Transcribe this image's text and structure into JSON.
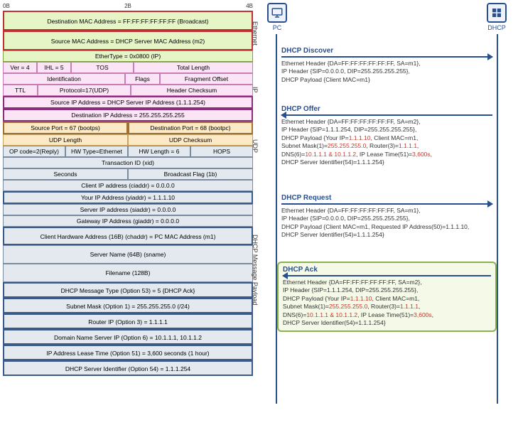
{
  "ruler": {
    "a": "0B",
    "b": "2B",
    "c": "4B"
  },
  "eth": {
    "dst": "Destination MAC Address = FF:FF:FF:FF:FF:FF (Broadcast)",
    "src": "Source MAC Address = DHCP Server MAC Address (m2)",
    "etype": "EtherType = 0x0800 (IP)",
    "label": "Ethernet"
  },
  "ip": {
    "ver": "Ver = 4",
    "ihl": "IHL = 5",
    "tos": "TOS",
    "tlen": "Total Length",
    "ident": "Identification",
    "flags": "Flags",
    "frag": "Fragment Offset",
    "ttl": "TTL",
    "proto": "Protocol=17(UDP)",
    "hcsum": "Header Checksum",
    "sip": "Source IP Address = DHCP Server IP Address (1.1.1.254)",
    "dip": "Destination IP Address = 255.255.255.255",
    "label": "IP"
  },
  "udp": {
    "sport": "Source Port = 67 (bootps)",
    "dport": "Destination Port = 68 (bootpc)",
    "len": "UDP Length",
    "csum": "UDP Checksum",
    "label": "UDP"
  },
  "pl": {
    "op": "OP code=2(Reply)",
    "hwtype": "HW Type=Ethernet",
    "hwlen": "HW Length = 6",
    "hops": "HOPS",
    "xid": "Transaction ID (xid)",
    "secs": "Seconds",
    "bflag": "Broadcast Flag (1b)",
    "ciaddr": "Client IP address (ciaddr) = 0.0.0.0",
    "yiaddr": "Your IP Address (yiaddr) = 1.1.1.10",
    "siaddr": "Server IP address (siaddr) = 0.0.0.0",
    "giaddr": "Gateway IP Address (giaddr) = 0.0.0.0",
    "chaddr": "Client Hardware Address (16B) (chaddr) = PC MAC Address (m1)",
    "sname": "Server Name (64B) (sname)",
    "file": "Filename (128B)",
    "opt53": "DHCP Message Type (Option 53) = 5 {DHCP Ack}",
    "opt1": "Subnet Mask (Option 1) = 255.255.255.0 (/24)",
    "opt3": "Router IP (Option 3) = 1.1.1.1",
    "opt6": "Domain Name Server IP (Option 6) = 10.1.1.1, 10.1.1.2",
    "opt51": "IP Address Lease Time (Option 51) = 3,600 seconds (1 hour)",
    "opt54": "DHCP Server Identifier (Option 54) = 1.1.1.254",
    "label": "DHCP Message Payload"
  },
  "nodes": {
    "pc": "PC",
    "dhcp": "DHCP"
  },
  "m1": {
    "title": "DHCP Discover",
    "l1": "Ethernet Header {DA=FF:FF:FF:FF:FF:FF, SA=m1},",
    "l2": "IP Header {SIP=0.0.0.0, DIP=255.255.255.255},",
    "l3": "DHCP Payload {Client MAC=m1}"
  },
  "m2": {
    "title": "DHCP Offer",
    "l1": "Ethernet Header {DA=FF:FF:FF:FF:FF:FF, SA=m2},",
    "l2": "IP Header {SIP=1.1.1.254, DIP=255.255.255.255},",
    "l3a": "DHCP Payload {Your IP=",
    "l3b": "1.1.1.10",
    "l3c": ", Client MAC=m1,",
    "l4a": "Subnet Mask(1)=",
    "l4b": "255.255.255.0",
    "l4c": ", Router(3)=",
    "l4d": "1.1.1.1",
    "l4e": ",",
    "l5a": "DNS(6)=",
    "l5b": "10.1.1.1 & 10.1.1.2",
    "l5c": ", IP Lease Time(51)=",
    "l5d": "3,600s",
    "l5e": ",",
    "l6": "DHCP Server Identifier(54)=1.1.1.254}"
  },
  "m3": {
    "title": "DHCP Request",
    "l1": "Ethernet Header {DA=FF:FF:FF:FF:FF:FF, SA=m1},",
    "l2": "IP Header {SIP=0.0.0.0, DIP=255.255.255.255},",
    "l3": "DHCP Payload {Client MAC=m1, Requested IP Address(50)=1.1.1.10,",
    "l4": "DHCP Server Identifier(54)=1.1.1.254}"
  },
  "m4": {
    "title": "DHCP Ack",
    "l1": "Ethernet Header {DA=FF:FF:FF:FF:FF:FF, SA=m2},",
    "l2": "IP Header {SIP=1.1.1.254, DIP=255.255.255.255},",
    "l3a": "DHCP Payload {Your IP=",
    "l3b": "1.1.1.10",
    "l3c": ", Client MAC=m1,",
    "l4a": "Subnet Mask(1)=",
    "l4b": "255.255.255.0",
    "l4c": ", Router(3)=",
    "l4d": "1.1.1.1",
    "l4e": ",",
    "l5a": "DNS(6)=",
    "l5b": "10.1.1.1 & 10.1.1.2",
    "l5c": ", IP Lease Time(51)=",
    "l5d": "3,600s",
    "l5e": ",",
    "l6": "DHCP Server Identifier(54)=1.1.1.254}"
  }
}
